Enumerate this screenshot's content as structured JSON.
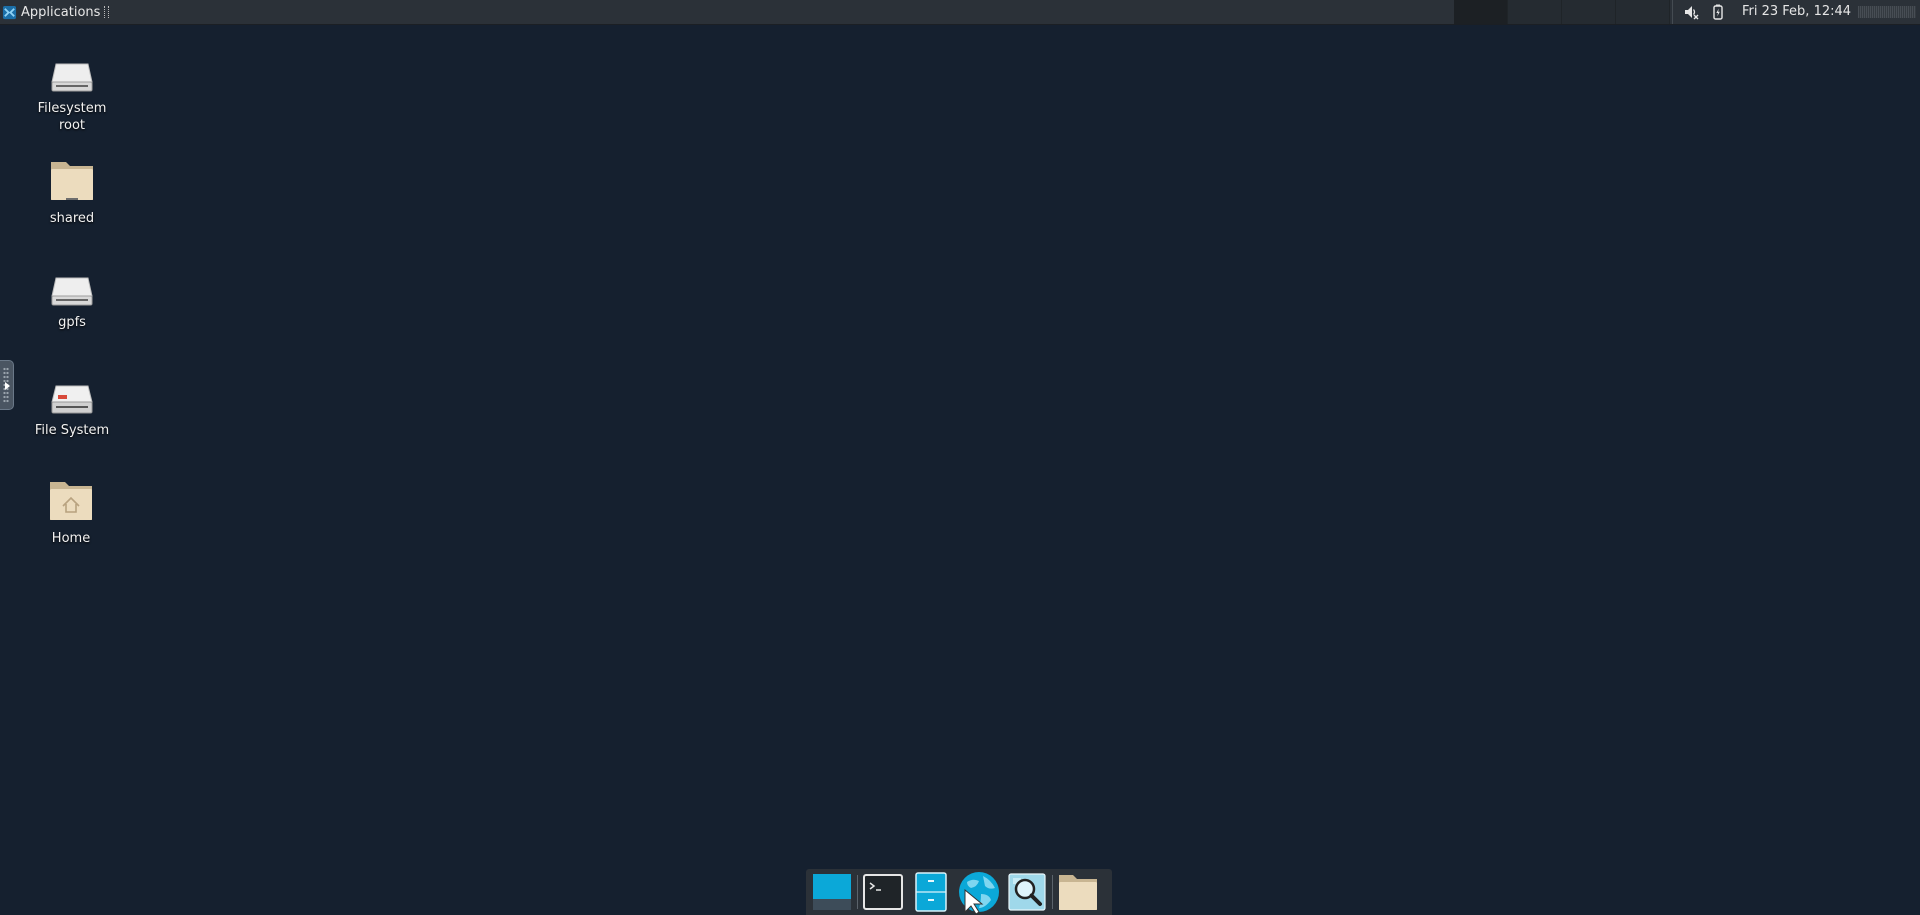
{
  "top_panel": {
    "applications_label": "Applications",
    "clock": "Fri 23 Feb, 12:44",
    "tray": [
      "speaker-muted-icon",
      "battery-icon"
    ]
  },
  "desktop_icons": [
    {
      "label": "Filesystem root",
      "icon": "drive-icon"
    },
    {
      "label": "shared",
      "icon": "folder-icon"
    },
    {
      "label": "gpfs",
      "icon": "drive-icon"
    },
    {
      "label": "File System",
      "icon": "harddisk-icon"
    },
    {
      "label": "Home",
      "icon": "home-folder-icon"
    }
  ],
  "dock": {
    "items": [
      "show-desktop-icon",
      "terminal-icon",
      "file-manager-icon",
      "web-browser-icon",
      "app-finder-icon",
      "folder-icon"
    ]
  },
  "colors": {
    "desktop_bg": "#15202f",
    "panel_bg": "#2b3138",
    "accent": "#0ba8d8"
  }
}
